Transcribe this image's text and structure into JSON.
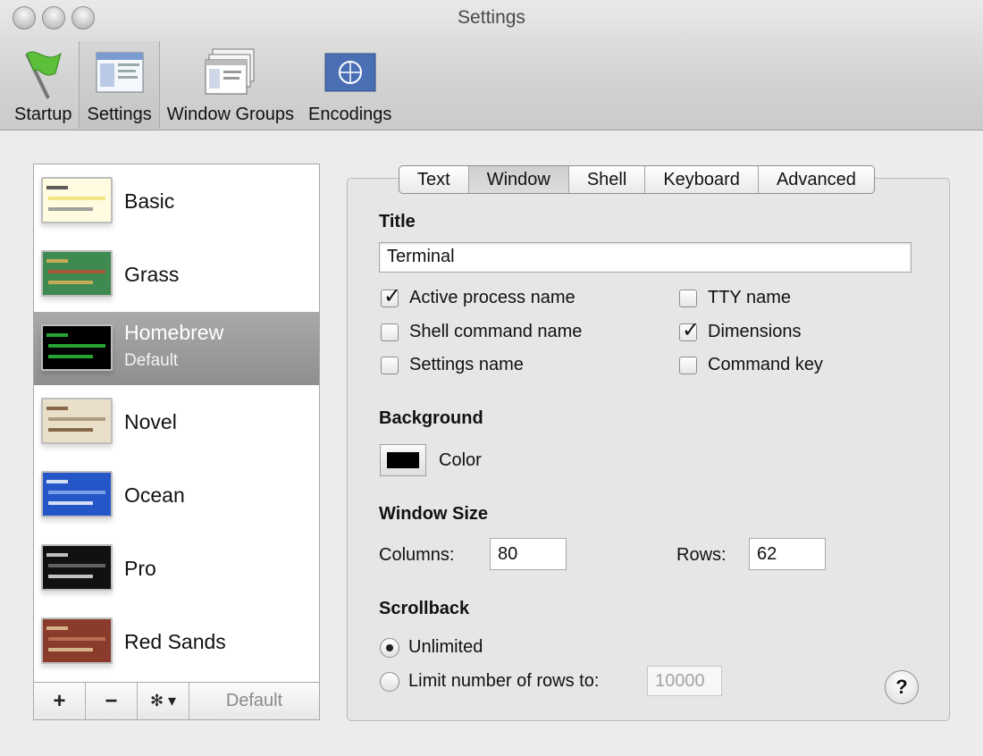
{
  "window": {
    "title": "Settings"
  },
  "toolbar": {
    "items": [
      {
        "label": "Startup",
        "icon": "flag-icon"
      },
      {
        "label": "Settings",
        "icon": "settings-window-icon",
        "selected": true
      },
      {
        "label": "Window Groups",
        "icon": "window-groups-icon"
      },
      {
        "label": "Encodings",
        "icon": "globe-flag-icon"
      }
    ]
  },
  "profiles": {
    "items": [
      {
        "name": "Basic",
        "bg": "#f7f2c8",
        "fg": "#333333"
      },
      {
        "name": "Grass",
        "bg": "#3f8a50",
        "fg": "#e6b35a"
      },
      {
        "name": "Homebrew",
        "sub": "Default",
        "bg": "#000000",
        "fg": "#2ecc40",
        "selected": true
      },
      {
        "name": "Novel",
        "bg": "#e9dfc8",
        "fg": "#6b4b2b"
      },
      {
        "name": "Ocean",
        "bg": "#2456c8",
        "fg": "#ffffff"
      },
      {
        "name": "Pro",
        "bg": "#111111",
        "fg": "#eeeeee"
      },
      {
        "name": "Red Sands",
        "bg": "#8a3b2b",
        "fg": "#e6d3a0"
      }
    ],
    "bottom": {
      "add": "+",
      "remove": "−",
      "gear": "✻ ▾",
      "default_label": "Default"
    }
  },
  "tabs": [
    "Text",
    "Window",
    "Shell",
    "Keyboard",
    "Advanced"
  ],
  "selected_tab": "Window",
  "title_section": {
    "heading": "Title",
    "value": "Terminal",
    "options": [
      {
        "label": "Active process name",
        "checked": true
      },
      {
        "label": "TTY name",
        "checked": false
      },
      {
        "label": "Shell command name",
        "checked": false
      },
      {
        "label": "Dimensions",
        "checked": true
      },
      {
        "label": "Settings name",
        "checked": false
      },
      {
        "label": "Command key",
        "checked": false
      }
    ]
  },
  "background": {
    "heading": "Background",
    "color_label": "Color",
    "color": "#000000"
  },
  "window_size": {
    "heading": "Window Size",
    "columns_label": "Columns:",
    "columns": "80",
    "rows_label": "Rows:",
    "rows": "62"
  },
  "scrollback": {
    "heading": "Scrollback",
    "unlimited_label": "Unlimited",
    "limit_label": "Limit number of rows to:",
    "limit_value": "10000",
    "selected": "unlimited"
  },
  "help": "?"
}
